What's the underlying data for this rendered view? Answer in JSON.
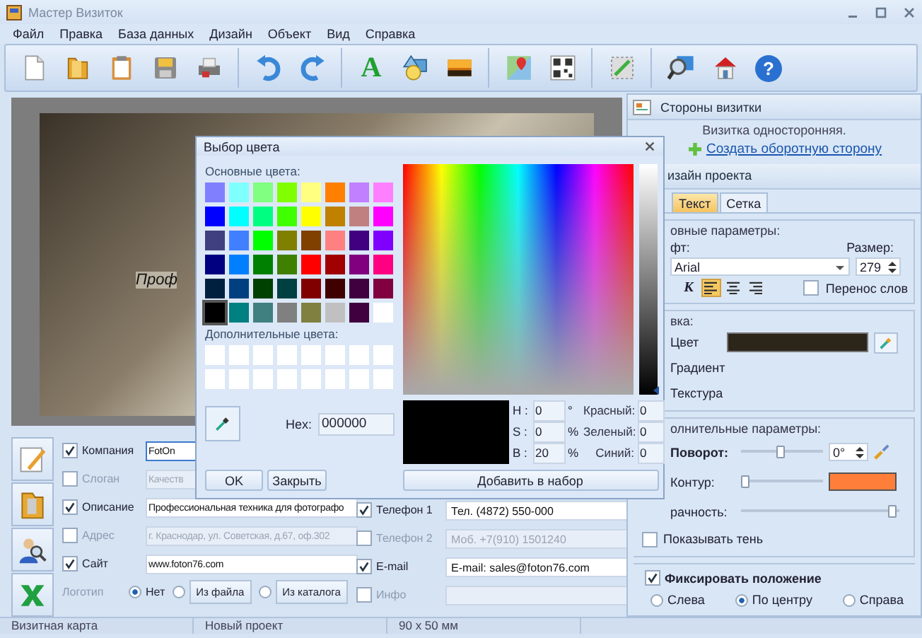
{
  "window": {
    "title": "Мастер Визиток"
  },
  "menu": [
    "Файл",
    "Правка",
    "База данных",
    "Дизайн",
    "Объект",
    "Вид",
    "Справка"
  ],
  "toolbar": {
    "text_tool_glyph": "A",
    "help_glyph": "?"
  },
  "canvas": {
    "visible_text": "Проф"
  },
  "form": {
    "left_fields": [
      {
        "label": "Компания",
        "checked": true,
        "value": "FotOn",
        "focused": true
      },
      {
        "label": "Слоган",
        "checked": false,
        "value": "Качеств",
        "focused": false
      },
      {
        "label": "Описание",
        "checked": true,
        "value": "Профессиональная техника для фотографо",
        "focused": false
      },
      {
        "label": "Адрес",
        "checked": false,
        "value": "г. Краснодар, ул. Советская, д.67, оф.302",
        "focused": false
      },
      {
        "label": "Сайт",
        "checked": true,
        "value": "www.foton76.com",
        "focused": false
      }
    ],
    "right_fields": [
      {
        "label": "Телефон 1",
        "checked": true,
        "value": "Тел. (4872) 550-000"
      },
      {
        "label": "Телефон 2",
        "checked": false,
        "value": "Моб. +7(910) 1501240"
      },
      {
        "label": "E-mail",
        "checked": true,
        "value": "E-mail: sales@foton76.com"
      },
      {
        "label": "Инфо",
        "checked": false
      }
    ],
    "logo": {
      "label": "Логотип",
      "options": [
        {
          "label": "Нет",
          "kind": "text",
          "selected": true
        },
        {
          "label": "Из файла",
          "kind": "button",
          "selected": false
        },
        {
          "label": "Из каталога",
          "kind": "button",
          "selected": false
        }
      ]
    }
  },
  "dialog": {
    "title": "Выбор цвета",
    "basic_colors_label": "Основные цвета:",
    "basic_colors": [
      {
        "color": "#8080ff",
        "selected": false
      },
      {
        "color": "#80ffff",
        "selected": false
      },
      {
        "color": "#80ff80",
        "selected": false
      },
      {
        "color": "#80ff00",
        "selected": false
      },
      {
        "color": "#ffff80",
        "selected": false
      },
      {
        "color": "#ff8000",
        "selected": false
      },
      {
        "color": "#c080ff",
        "selected": false
      },
      {
        "color": "#ff80ff",
        "selected": false
      },
      {
        "color": "#0000ff",
        "selected": false
      },
      {
        "color": "#00ffff",
        "selected": false
      },
      {
        "color": "#00ff80",
        "selected": false
      },
      {
        "color": "#40ff00",
        "selected": false
      },
      {
        "color": "#ffff00",
        "selected": false
      },
      {
        "color": "#c08000",
        "selected": false
      },
      {
        "color": "#c08080",
        "selected": false
      },
      {
        "color": "#ff00ff",
        "selected": false
      },
      {
        "color": "#404080",
        "selected": false
      },
      {
        "color": "#4080ff",
        "selected": false
      },
      {
        "color": "#00ff00",
        "selected": false
      },
      {
        "color": "#808000",
        "selected": false
      },
      {
        "color": "#804000",
        "selected": false
      },
      {
        "color": "#ff8080",
        "selected": false
      },
      {
        "color": "#400080",
        "selected": false
      },
      {
        "color": "#8000ff",
        "selected": false
      },
      {
        "color": "#000080",
        "selected": false
      },
      {
        "color": "#0080ff",
        "selected": false
      },
      {
        "color": "#008000",
        "selected": false
      },
      {
        "color": "#408000",
        "selected": false
      },
      {
        "color": "#ff0000",
        "selected": false
      },
      {
        "color": "#a00000",
        "selected": false
      },
      {
        "color": "#800080",
        "selected": false
      },
      {
        "color": "#ff0080",
        "selected": false
      },
      {
        "color": "#002040",
        "selected": false
      },
      {
        "color": "#004080",
        "selected": false
      },
      {
        "color": "#004000",
        "selected": false
      },
      {
        "color": "#004040",
        "selected": false
      },
      {
        "color": "#800000",
        "selected": false
      },
      {
        "color": "#400000",
        "selected": false
      },
      {
        "color": "#400040",
        "selected": false
      },
      {
        "color": "#800040",
        "selected": false
      },
      {
        "color": "#000000",
        "selected": true
      },
      {
        "color": "#008080",
        "selected": false
      },
      {
        "color": "#408080",
        "selected": false
      },
      {
        "color": "#808080",
        "selected": false
      },
      {
        "color": "#808040",
        "selected": false
      },
      {
        "color": "#c0c0c0",
        "selected": false
      },
      {
        "color": "#400040",
        "selected": false
      },
      {
        "color": "#ffffff",
        "selected": false
      }
    ],
    "custom_colors_label": "Дополнительные цвета:",
    "custom_colors": [
      {
        "color": "#ffffff"
      },
      {
        "color": "#ffffff"
      },
      {
        "color": "#ffffff"
      },
      {
        "color": "#ffffff"
      },
      {
        "color": "#ffffff"
      },
      {
        "color": "#ffffff"
      },
      {
        "color": "#ffffff"
      },
      {
        "color": "#ffffff"
      },
      {
        "color": "#ffffff"
      },
      {
        "color": "#ffffff"
      },
      {
        "color": "#ffffff"
      },
      {
        "color": "#ffffff"
      },
      {
        "color": "#ffffff"
      },
      {
        "color": "#ffffff"
      },
      {
        "color": "#ffffff"
      },
      {
        "color": "#ffffff"
      }
    ],
    "hex_label": "Hex:",
    "hex": "000000",
    "brightness": {
      "level": 0
    },
    "hsb": [
      {
        "label": "H :",
        "value": "0",
        "unit": "°"
      },
      {
        "label": "S :",
        "value": "0",
        "unit": "%"
      },
      {
        "label": "B :",
        "value": "20",
        "unit": "%"
      }
    ],
    "rgb": [
      {
        "label": "Красный:",
        "value": "0"
      },
      {
        "label": "Зеленый:",
        "value": "0"
      },
      {
        "label": "Синий:",
        "value": "0"
      }
    ],
    "ok": "OK",
    "close": "Закрыть",
    "add": "Добавить в набор"
  },
  "right_panel": {
    "sides": {
      "title": "Стороны визитки",
      "status": "Визитка односторонняя.",
      "link": "Создать оборотную сторону"
    },
    "design": {
      "title": "изайн проекта",
      "tabs": [
        {
          "label": "Текст",
          "selected": true
        },
        {
          "label": "Сетка",
          "selected": false
        }
      ],
      "main_group": {
        "title": "овные параметры:",
        "font_label": "фт:",
        "font": "Arial",
        "size_label": "Размер:",
        "size": "279",
        "italic_glyph": "К",
        "alignment": [
          {
            "selected": true
          },
          {
            "selected": false
          },
          {
            "selected": false
          }
        ],
        "wrap": {
          "label": "Перенос слов",
          "checked": false
        }
      },
      "fill_group": {
        "title": "вка:",
        "options": [
          "Цвет",
          "Градиент",
          "Текстура"
        ],
        "color": "#2b2619"
      },
      "extra_group": {
        "title": "олнительные параметры:",
        "sliders": [
          {
            "label": "Поворот:",
            "bold": true,
            "level": 0.5,
            "kind": "spinner",
            "value": "0°"
          },
          {
            "label": "Контур:",
            "bold": false,
            "level": 0,
            "kind": "color",
            "color": "#ff7f3a"
          },
          {
            "label": "рачность:",
            "bold": false,
            "level": 1,
            "kind": "plain"
          }
        ],
        "shadow": {
          "label": "Показывать тень",
          "checked": false
        }
      }
    },
    "position": {
      "fixed": {
        "label": "Фиксировать положение",
        "checked": true
      },
      "options": [
        {
          "label": "Слева",
          "selected": false
        },
        {
          "label": "По центру",
          "selected": true
        },
        {
          "label": "Справа",
          "selected": false
        }
      ]
    }
  },
  "status_bar": [
    "Визитная карта",
    "Новый проект",
    "90 x 50 мм"
  ]
}
